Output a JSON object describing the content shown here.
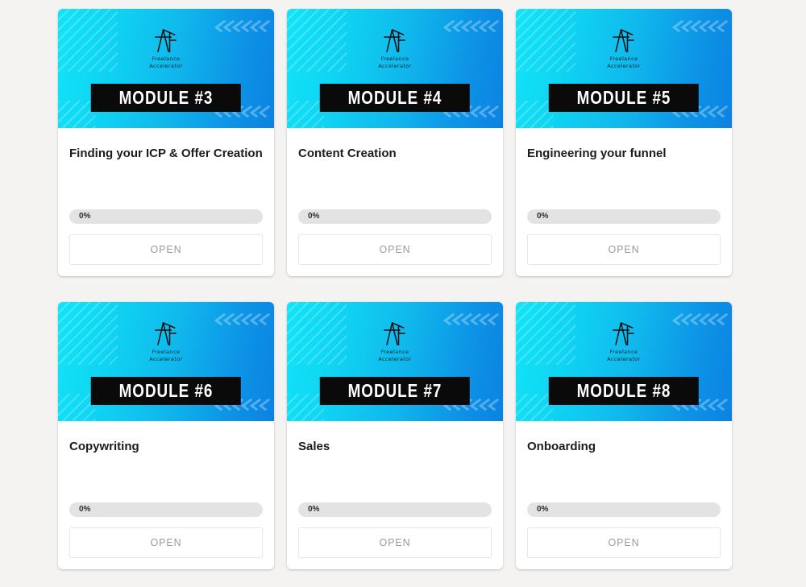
{
  "page": {
    "background_color": "#f4f3f2"
  },
  "brand": {
    "logo_icon": "fa-monogram-icon",
    "name_line_1": "Freelance",
    "name_line_2": "Accelerator"
  },
  "theme": {
    "gradient_start": "#12e4f7",
    "gradient_end": "#0b82e2",
    "badge_background": "#0a0a0a",
    "badge_text_color": "#ffffff",
    "progress_track": "#e3e3e3",
    "button_text_color": "#9b9b9b"
  },
  "cards": [
    {
      "badge": "MODULE #3",
      "title": "Finding your ICP & Offer Creation",
      "progress_label": "0%",
      "progress_value": 0,
      "button_label": "OPEN"
    },
    {
      "badge": "MODULE #4",
      "title": "Content Creation",
      "progress_label": "0%",
      "progress_value": 0,
      "button_label": "OPEN"
    },
    {
      "badge": "MODULE #5",
      "title": "Engineering your funnel",
      "progress_label": "0%",
      "progress_value": 0,
      "button_label": "OPEN"
    },
    {
      "badge": "MODULE #6",
      "title": "Copywriting",
      "progress_label": "0%",
      "progress_value": 0,
      "button_label": "OPEN"
    },
    {
      "badge": "MODULE #7",
      "title": "Sales",
      "progress_label": "0%",
      "progress_value": 0,
      "button_label": "OPEN"
    },
    {
      "badge": "MODULE #8",
      "title": "Onboarding",
      "progress_label": "0%",
      "progress_value": 0,
      "button_label": "OPEN"
    }
  ]
}
